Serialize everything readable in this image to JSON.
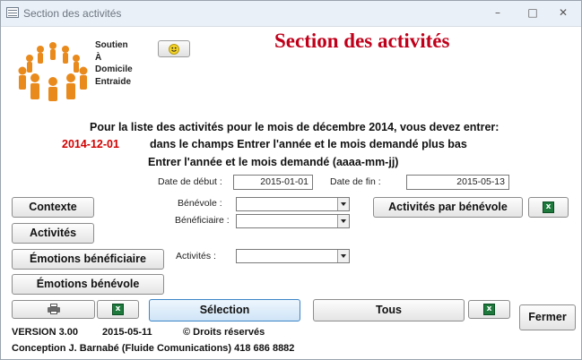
{
  "window": {
    "title": "Section des activités"
  },
  "header": {
    "org_lines": [
      "Soutien",
      "À",
      "Domicile",
      "Entraide"
    ],
    "main_title": "Section des activités"
  },
  "instructions": {
    "line1": "Pour la liste des activités pour le mois de décembre 2014, vous devez entrer:",
    "example_value": "2014-12-01",
    "line2": "dans le champs Entrer l'année et le mois demandé plus bas",
    "line3": "Entrer l'année et le mois demandé (aaaa-mm-jj)"
  },
  "dates": {
    "start_label": "Date de début :",
    "start_value": "2015-01-01",
    "end_label": "Date de fin :",
    "end_value": "2015-05-13"
  },
  "filters": {
    "benevole_label": "Bénévole :",
    "beneficiaire_label": "Bénéficiaire :",
    "activites_label": "Activités :"
  },
  "buttons": {
    "contexte": "Contexte",
    "activites": "Activités",
    "emotions_beneficiaire": "Émotions bénéficiaire",
    "emotions_benevole": "Émotions bénévole",
    "activites_par_benevole": "Activités par bénévole",
    "selection": "Sélection",
    "tous": "Tous",
    "fermer": "Fermer"
  },
  "footer": {
    "version": "VERSION 3.00",
    "date": "2015-05-11",
    "rights": "© Droits réservés",
    "credits": "Conception J. Barnabé (Fluide Comunications) 418 686 8882"
  },
  "icons": {
    "excel": "excel-icon",
    "printer": "printer-icon",
    "smiley": "smiley-icon",
    "logo": "logo-people-circle-icon"
  },
  "colors": {
    "title_red": "#c0001a",
    "logo_orange": "#e98a1c",
    "example_red": "#d20000"
  }
}
